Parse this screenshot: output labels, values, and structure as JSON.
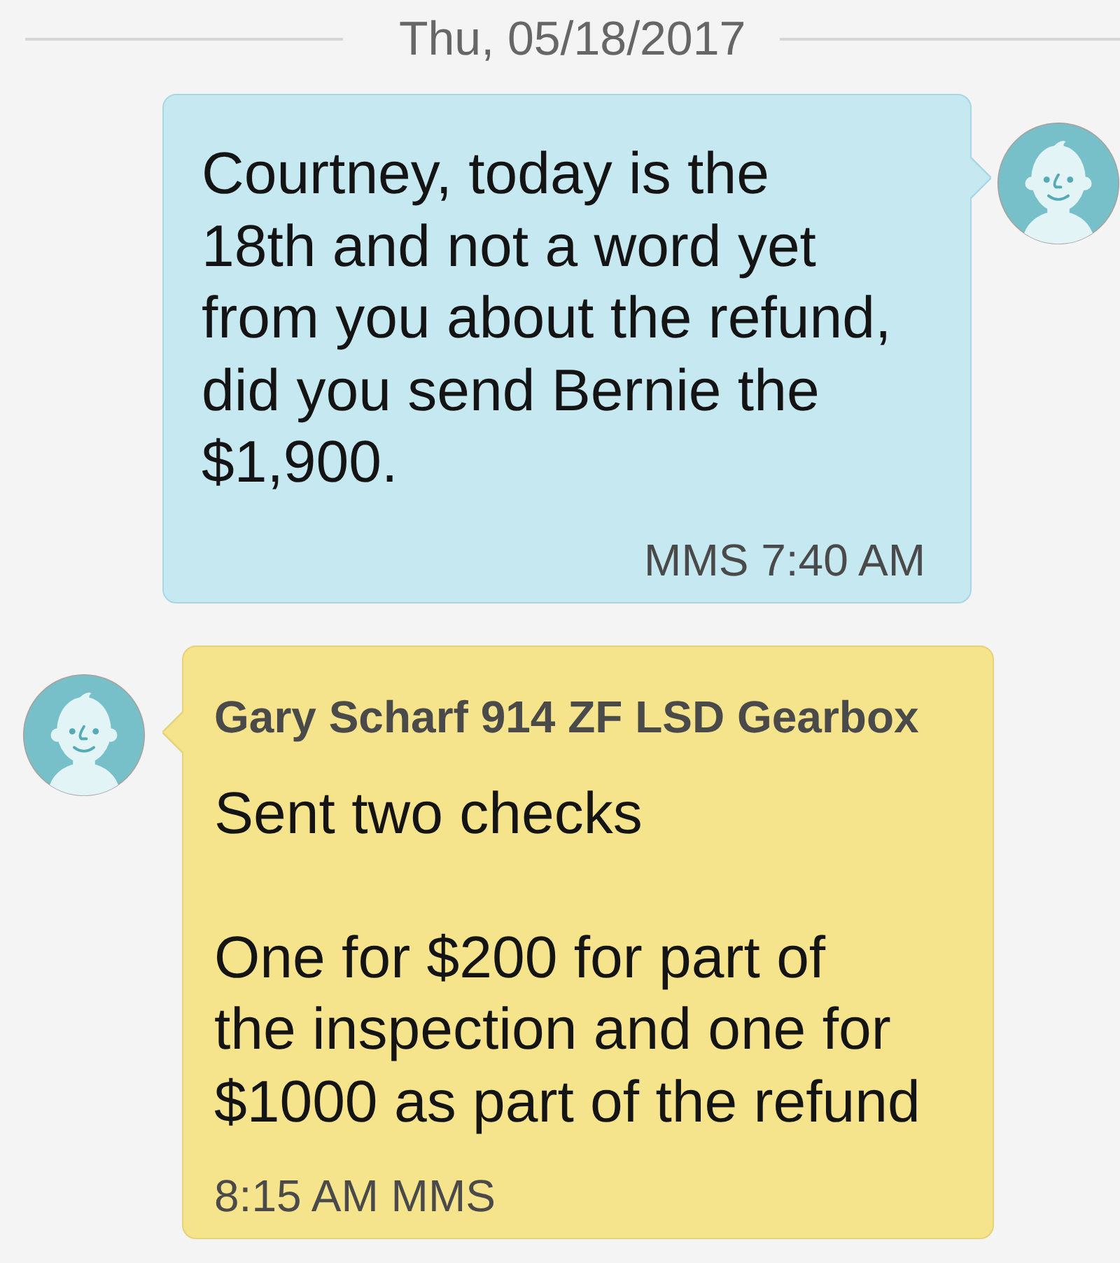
{
  "date_divider": {
    "label": "Thu, 05/18/2017"
  },
  "messages": [
    {
      "kind": "outgoing",
      "text": "Courtney, today is the 18th and not a word yet from you about the refund, did you send Bernie the $1,900.",
      "meta": "MMS 7:40 AM"
    },
    {
      "kind": "incoming",
      "sender": "Gary Scharf 914 ZF LSD Gearbox",
      "text": "Sent two checks\n\nOne for $200 for part of the inspection and one for $1000 as part of the refund",
      "meta": "8:15 AM MMS"
    }
  ]
}
